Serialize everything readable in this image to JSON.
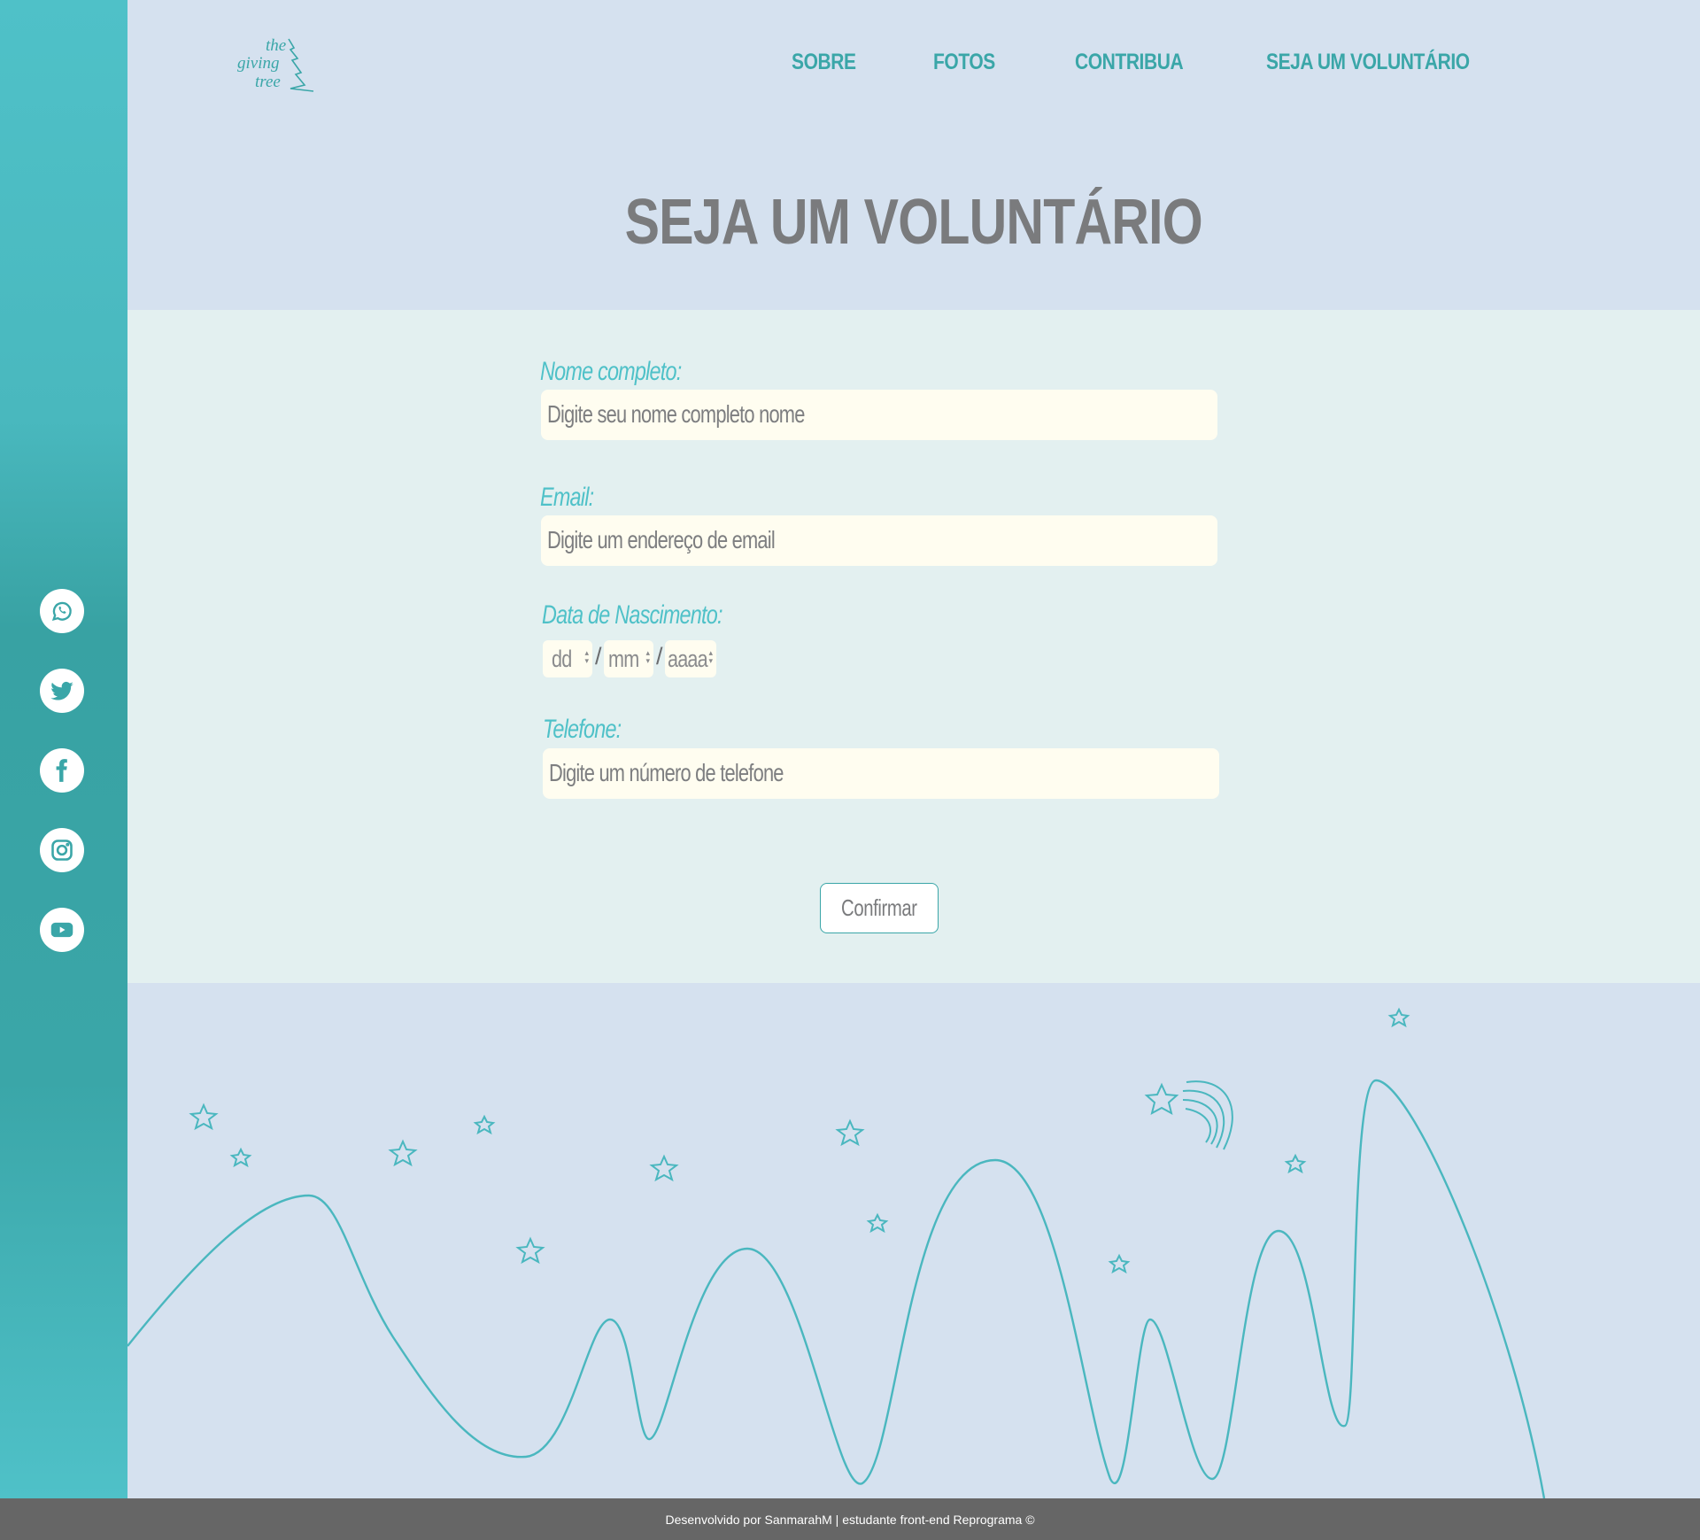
{
  "brand": {
    "logo_line1": "the",
    "logo_line2": "giving",
    "logo_line3": "tree",
    "accent_color": "#3aa6a8",
    "title_color": "#7a7b7d"
  },
  "nav": {
    "items": [
      {
        "label": "SOBRE"
      },
      {
        "label": "FOTOS"
      },
      {
        "label": "CONTRIBUA"
      },
      {
        "label": "SEJA UM VOLUNTÁRIO"
      }
    ]
  },
  "page": {
    "title": "SEJA UM VOLUNTÁRIO"
  },
  "social": {
    "icons": [
      "whatsapp-icon",
      "twitter-icon",
      "facebook-icon",
      "instagram-icon",
      "youtube-icon"
    ]
  },
  "form": {
    "name_label": "Nome completo:",
    "name_placeholder": "Digite seu nome completo nome",
    "email_label": "Email:",
    "email_placeholder": "Digite um endereço de email",
    "birth_label": "Data de Nascimento:",
    "birth_day": "dd",
    "birth_month": "mm",
    "birth_year": "aaaa",
    "date_separator": "/",
    "phone_label": "Telefone:",
    "phone_placeholder": "Digite um número de telefone",
    "submit_label": "Confirmar"
  },
  "footer": {
    "text": "Desenvolvido por SanmarahM | estudante front-end Reprograma ©"
  }
}
